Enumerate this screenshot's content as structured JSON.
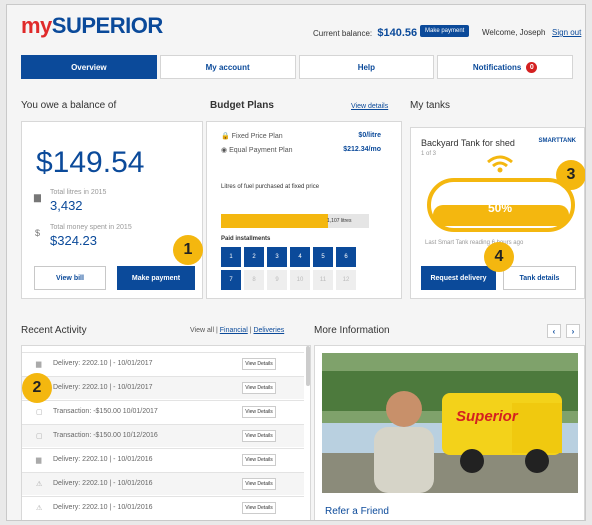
{
  "header": {
    "logo_prefix": "my",
    "logo_main": "SUPERIOR",
    "current_balance_label": "Current balance:",
    "current_balance_value": "$140.56",
    "make_payment_small": "Make payment",
    "welcome": "Welcome, Joseph",
    "sign_out": "Sign out"
  },
  "tabs": [
    {
      "label": "Overview"
    },
    {
      "label": "My account"
    },
    {
      "label": "Help"
    },
    {
      "label": "Notifications",
      "count": "0"
    }
  ],
  "balance": {
    "title": "You owe a balance of",
    "amount": "$149.54",
    "litres_label": "Total litres in 2015",
    "litres_value": "3,432",
    "money_label": "Total money spent in 2015",
    "money_value": "$324.23",
    "view_bill": "View bill",
    "make_payment": "Make payment"
  },
  "budget": {
    "title": "Budget Plans",
    "view_details": "View details",
    "fixed_label": "Fixed Price Plan",
    "fixed_value": "$0/litre",
    "equal_label": "Equal Payment Plan",
    "equal_value": "$212.34/mo",
    "litres_fixed_label": "Litres of fuel purchased at fixed price",
    "litres_fixed_bar": "1,107 litres",
    "litres_fixed_fraction": 0.72,
    "paid_installments_label": "Paid installments",
    "installments": [
      "1",
      "2",
      "3",
      "4",
      "5",
      "6",
      "7",
      "8",
      "9",
      "10",
      "11",
      "12"
    ],
    "paid_count": 7
  },
  "tanks": {
    "title": "My tanks",
    "tank_name": "Backyard Tank for shed",
    "tank_count": "1 of 3",
    "smart_label": "SMARTTANK",
    "level_percent": "50%",
    "level_fraction": 0.5,
    "last_reading": "Last Smart Tank reading 6 hours ago",
    "request_delivery": "Request delivery",
    "tank_details": "Tank details"
  },
  "activity": {
    "title": "Recent Activity",
    "view_all": "View all",
    "financial": "Financial",
    "deliveries": "Deliveries",
    "sep": "|",
    "rows": [
      {
        "icon": "truck-icon",
        "glyph": "▆",
        "text": "Delivery: 2202.10 | - 10/01/2017",
        "button": "View Details"
      },
      {
        "icon": "truck-icon",
        "glyph": "▆",
        "text": "Delivery: 2202.10 | - 10/01/2017",
        "button": "View Details"
      },
      {
        "icon": "document-icon",
        "glyph": "▢",
        "text": "Transaction: -$150.00 10/01/2017",
        "button": "View Details"
      },
      {
        "icon": "document-icon",
        "glyph": "▢",
        "text": "Transaction: -$150.00 10/12/2016",
        "button": "View Details"
      },
      {
        "icon": "truck-icon",
        "glyph": "▆",
        "text": "Delivery: 2202.10 | - 10/01/2016",
        "button": "View Details"
      },
      {
        "icon": "warning-icon",
        "glyph": "⚠",
        "text": "Delivery: 2202.10 | - 10/01/2016",
        "button": "View Details"
      },
      {
        "icon": "warning-icon",
        "glyph": "⚠",
        "text": "Delivery: 2202.10 | - 10/01/2016",
        "button": "View Details"
      }
    ]
  },
  "more_info": {
    "title": "More Information",
    "prev": "‹",
    "next": "›",
    "truck_brand": "Superior",
    "article_title": "Refer a Friend"
  },
  "badges": [
    "1",
    "2",
    "3",
    "4"
  ],
  "colors": {
    "brand_blue": "#0b4a9a",
    "brand_red": "#e02a2a",
    "accent_yellow": "#f4b70f"
  }
}
